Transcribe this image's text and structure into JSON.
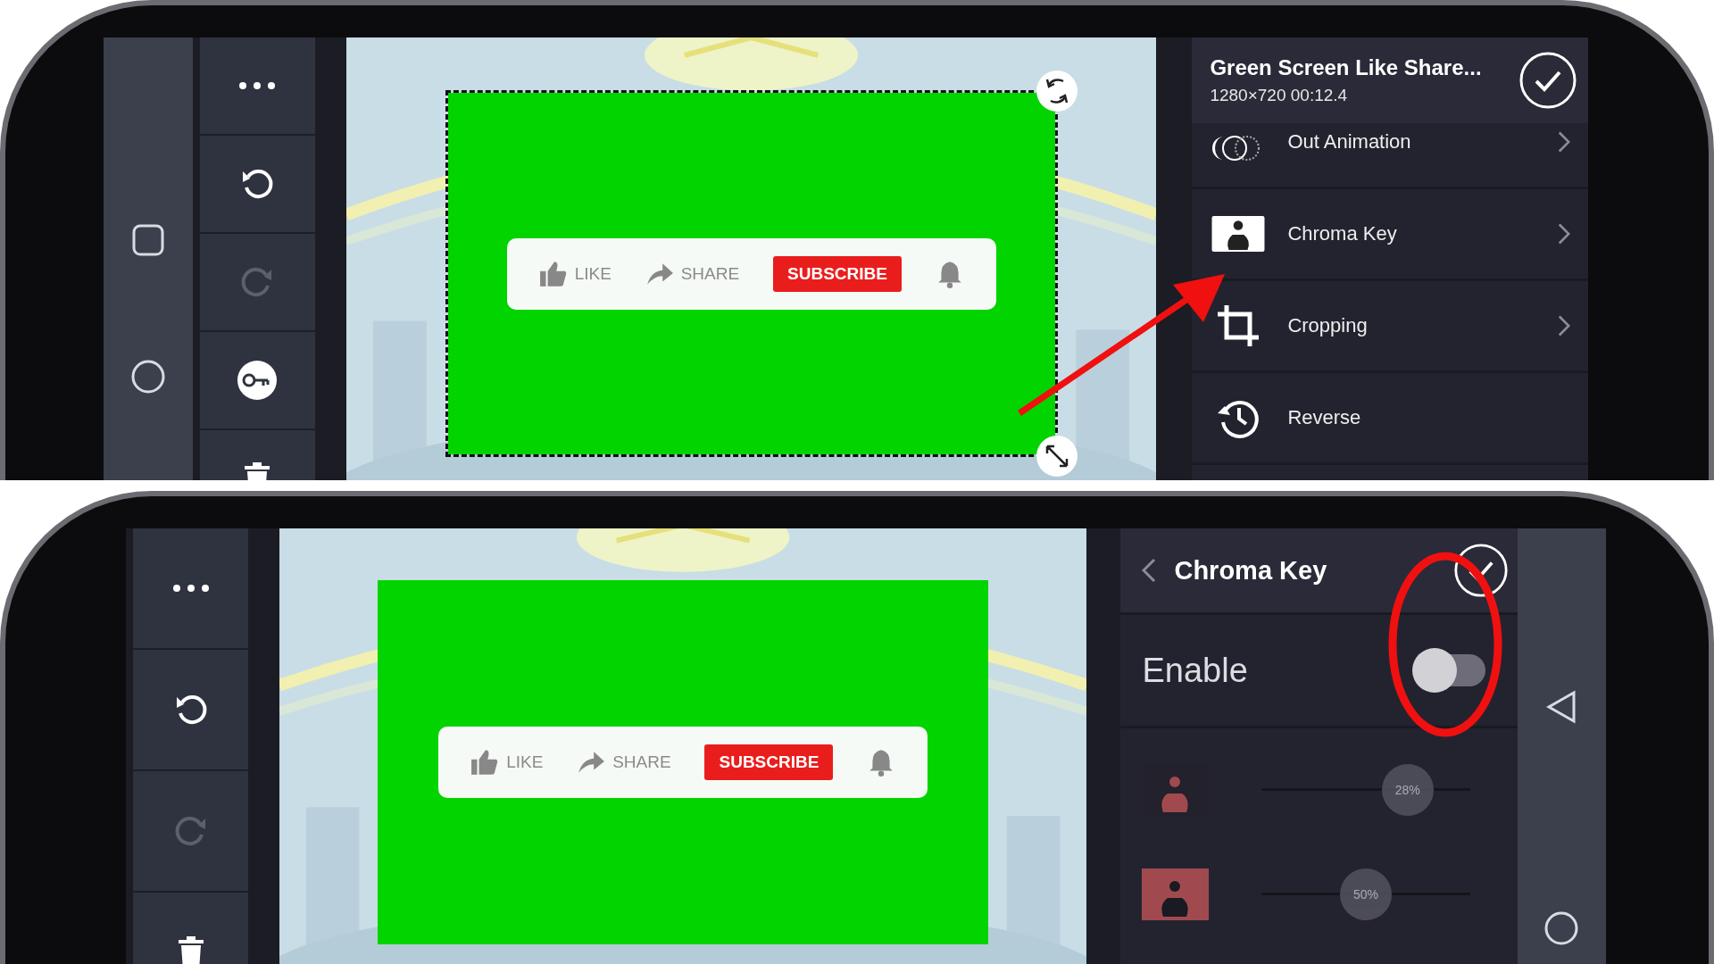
{
  "top_screen": {
    "preview": {
      "selected": true,
      "like": "LIKE",
      "share": "SHARE",
      "subscribe": "SUBSCRIBE"
    },
    "panel": {
      "title": "Green Screen Like Share...",
      "meta": "1280×720  00:12.4",
      "items": [
        {
          "kind": "animation",
          "label": "Out Animation",
          "chevron": true
        },
        {
          "kind": "chroma",
          "label": "Chroma Key",
          "chevron": true
        },
        {
          "kind": "crop",
          "label": "Cropping",
          "chevron": true
        },
        {
          "kind": "reverse",
          "label": "Reverse",
          "chevron": false
        }
      ]
    }
  },
  "bottom_screen": {
    "preview": {
      "selected": false,
      "like": "LIKE",
      "share": "SHARE",
      "subscribe": "SUBSCRIBE"
    },
    "panel": {
      "title": "Chroma Key",
      "enable": {
        "label": "Enable",
        "on": false
      },
      "sliders": [
        {
          "kind": "subject",
          "reading": "28%",
          "level": 0.7
        },
        {
          "kind": "background",
          "reading": "50%",
          "level": 0.5
        }
      ]
    }
  }
}
